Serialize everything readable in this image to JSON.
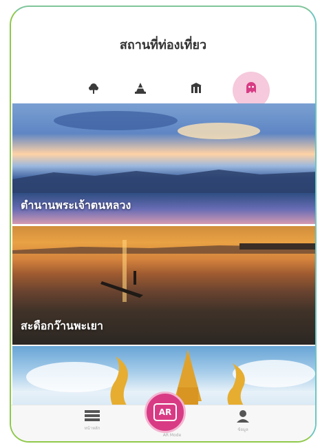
{
  "header": {
    "title": "สถานที่ท่องเที่ยว"
  },
  "categories": [
    {
      "icon": "tree-icon",
      "label": "",
      "active": false
    },
    {
      "icon": "pagoda-icon",
      "label": "",
      "active": false
    },
    {
      "icon": "building-icon",
      "label": "",
      "active": false
    },
    {
      "icon": "ghost-icon",
      "label": "",
      "active": true
    }
  ],
  "cards": [
    {
      "title": "ตำนานพระเจ้าตนหลวง"
    },
    {
      "title": "สะดือกว๊านพะเยา"
    },
    {
      "title": ""
    }
  ],
  "tabbar": {
    "home_label": "หน้าหลัก",
    "ar_label": "AR",
    "ar_mode_label": "AR Mode",
    "profile_label": "ข้อมูล"
  },
  "colors": {
    "accent": "#d83b84",
    "accent_light": "#f6c9dc",
    "frame_border": "#8fc84a"
  }
}
